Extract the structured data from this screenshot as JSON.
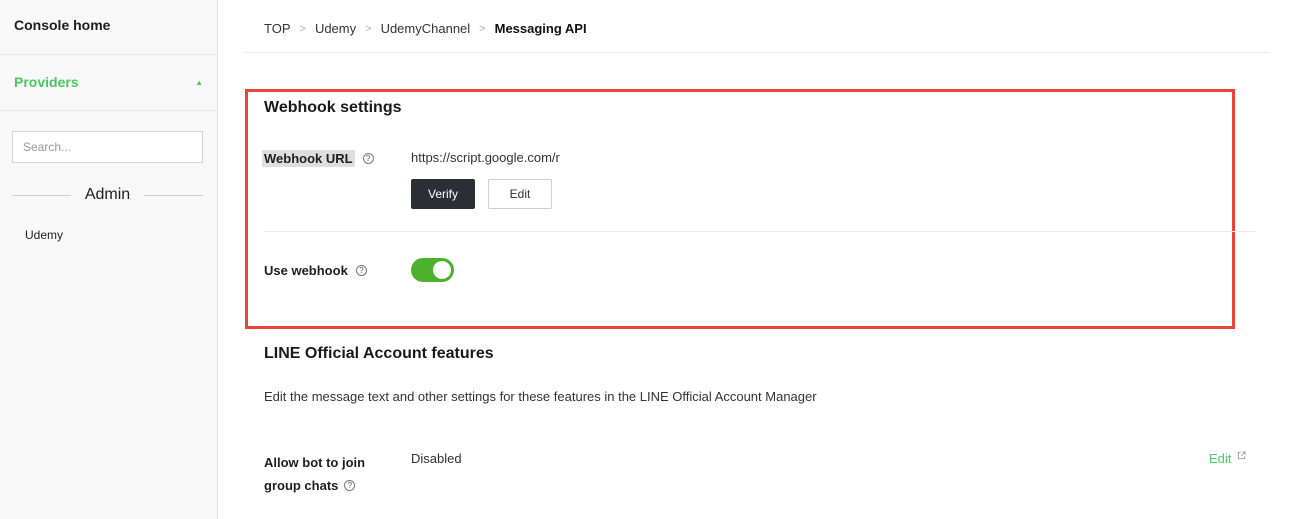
{
  "sidebar": {
    "console_home": "Console home",
    "providers": "Providers",
    "providers_caret": "▲",
    "search_placeholder": "Search...",
    "section_title": "Admin",
    "items": [
      "Udemy"
    ]
  },
  "breadcrumb": [
    "TOP",
    "Udemy",
    "UdemyChannel",
    "Messaging API"
  ],
  "webhook": {
    "title": "Webhook settings",
    "url_label": "Webhook URL",
    "url_value": "https://script.google.com/r",
    "verify_label": "Verify",
    "edit_label": "Edit",
    "use_label": "Use webhook",
    "use_enabled": true,
    "help_glyph": "?"
  },
  "oa_features": {
    "title": "LINE Official Account features",
    "description": "Edit the message text and other settings for these features in the LINE Official Account Manager",
    "bot_label_line1": "Allow bot to join",
    "bot_label_line2": "group chats",
    "bot_value": "Disabled",
    "edit_label": "Edit"
  },
  "colors": {
    "accent_green": "#4cc764",
    "toggle_green": "#4bb02c",
    "highlight_red": "#e7453b",
    "verify_dark": "#2b2f33"
  },
  "icons": {
    "help": "help-circle-icon",
    "external": "external-link-icon",
    "caret": "caret-up-icon"
  }
}
